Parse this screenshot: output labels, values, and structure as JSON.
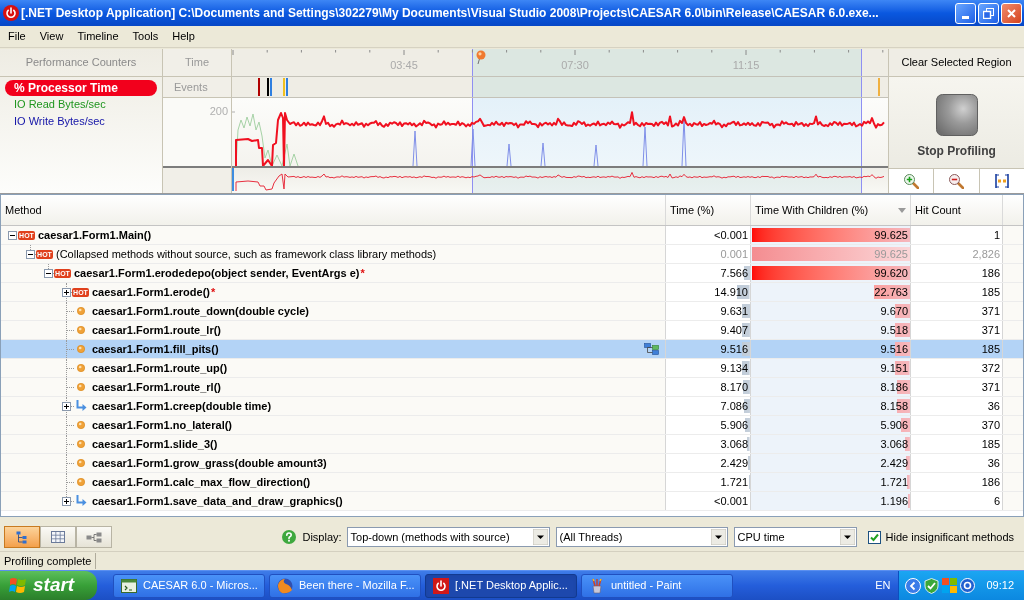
{
  "window": {
    "title": "[.NET Desktop Application] C:\\Documents and Settings\\302279\\My Documents\\Visual Studio 2008\\Projects\\CAESAR 6.0\\bin\\Release\\CAESAR 6.0.exe..."
  },
  "menu": [
    "File",
    "View",
    "Timeline",
    "Tools",
    "Help"
  ],
  "counters": {
    "header": "Performance Counters",
    "items": [
      {
        "label": "% Processor Time",
        "color": "#f2001c",
        "selected": true
      },
      {
        "label": "IO Read Bytes/sec",
        "color": "#1f961f",
        "selected": false
      },
      {
        "label": "IO Write Bytes/sec",
        "color": "#1414a8",
        "selected": false
      }
    ]
  },
  "timeline": {
    "time_label": "Time",
    "events_label": "Events",
    "ticks": [
      "03:45",
      "07:30",
      "11:15"
    ],
    "y_tick": "200",
    "events": [
      {
        "color": "#b00000"
      },
      {
        "color": "#000000"
      },
      {
        "color": "#2f7fe0"
      },
      {
        "color": "#f0c020"
      },
      {
        "color": "#2f7fe0"
      },
      {
        "color": "#f0b040"
      }
    ]
  },
  "actions": {
    "clear": "Clear Selected Region",
    "stop": "Stop Profiling"
  },
  "table": {
    "columns": [
      {
        "label": "Method",
        "sorted": false
      },
      {
        "label": "Time (%)",
        "sorted": false
      },
      {
        "label": "Time With Children (%)",
        "sorted": true
      },
      {
        "label": "Hit Count",
        "sorted": false
      }
    ],
    "rows": [
      {
        "kind": "hot",
        "badge": "HOT",
        "name": "caesar1.Form1.Main()",
        "expanded": true,
        "selected": false,
        "dimmed": false,
        "time": {
          "text": "<0.001"
        },
        "time_with_children": {
          "text": "99.625",
          "level": 0.99625
        },
        "hit_count": "1",
        "children": [
          {
            "kind": "hot",
            "badge": "HOT",
            "name": "(Collapsed methods without source, such as framework class library methods)",
            "expanded": true,
            "selected": false,
            "dimmed": true,
            "time": {
              "text": "0.001"
            },
            "time_with_children": {
              "text": "99.625",
              "level": 0.99625
            },
            "hit_count": "2,826",
            "children": [
              {
                "kind": "hot",
                "badge": "HOT",
                "name": "caesar1.Form1.erodedepo(object sender, EventArgs e)",
                "suffix": "*",
                "expanded": true,
                "selected": false,
                "dimmed": false,
                "time": {
                  "text": "7.566",
                  "level": 0.07566
                },
                "time_with_children": {
                  "text": "99.620",
                  "level": 0.9962
                },
                "hit_count": "186",
                "children": [
                  {
                    "kind": "hot",
                    "badge": "HOT",
                    "name": "caesar1.Form1.erode()",
                    "suffix": "*",
                    "expanded": false,
                    "selected": false,
                    "dimmed": false,
                    "time": {
                      "text": "14.910",
                      "level": 0.1491
                    },
                    "time_with_children": {
                      "text": "22.763",
                      "level": 0.22763
                    },
                    "hit_count": "185"
                  },
                  {
                    "kind": "method",
                    "name": "caesar1.Form1.route_down(double cycle)",
                    "selected": false,
                    "dimmed": false,
                    "time": {
                      "text": "9.631",
                      "level": 0.09631
                    },
                    "time_with_children": {
                      "text": "9.670",
                      "level": 0.0967
                    },
                    "hit_count": "371"
                  },
                  {
                    "kind": "method",
                    "name": "caesar1.Form1.route_lr()",
                    "selected": false,
                    "dimmed": false,
                    "time": {
                      "text": "9.407",
                      "level": 0.09407
                    },
                    "time_with_children": {
                      "text": "9.518",
                      "level": 0.09518
                    },
                    "hit_count": "371"
                  },
                  {
                    "kind": "method",
                    "name": "caesar1.Form1.fill_pits()",
                    "selected": true,
                    "dimmed": false,
                    "time": {
                      "text": "9.516",
                      "level": 0.09516
                    },
                    "time_with_children": {
                      "text": "9.516",
                      "level": 0.09516
                    },
                    "hit_count": "185"
                  },
                  {
                    "kind": "method",
                    "name": "caesar1.Form1.route_up()",
                    "selected": false,
                    "dimmed": false,
                    "time": {
                      "text": "9.134",
                      "level": 0.09134
                    },
                    "time_with_children": {
                      "text": "9.151",
                      "level": 0.09151
                    },
                    "hit_count": "372"
                  },
                  {
                    "kind": "method",
                    "name": "caesar1.Form1.route_rl()",
                    "selected": false,
                    "dimmed": false,
                    "time": {
                      "text": "8.170",
                      "level": 0.0817
                    },
                    "time_with_children": {
                      "text": "8.186",
                      "level": 0.08186
                    },
                    "hit_count": "371"
                  },
                  {
                    "kind": "call",
                    "name": "caesar1.Form1.creep(double time)",
                    "expanded": false,
                    "selected": false,
                    "dimmed": false,
                    "time": {
                      "text": "7.086",
                      "level": 0.07086
                    },
                    "time_with_children": {
                      "text": "8.158",
                      "level": 0.08158
                    },
                    "hit_count": "36"
                  },
                  {
                    "kind": "method",
                    "name": "caesar1.Form1.no_lateral()",
                    "selected": false,
                    "dimmed": false,
                    "time": {
                      "text": "5.906",
                      "level": 0.05906
                    },
                    "time_with_children": {
                      "text": "5.906",
                      "level": 0.05906
                    },
                    "hit_count": "370"
                  },
                  {
                    "kind": "method",
                    "name": "caesar1.Form1.slide_3()",
                    "selected": false,
                    "dimmed": false,
                    "time": {
                      "text": "3.068",
                      "level": 0.03068
                    },
                    "time_with_children": {
                      "text": "3.068",
                      "level": 0.03068
                    },
                    "hit_count": "185"
                  },
                  {
                    "kind": "method",
                    "name": "caesar1.Form1.grow_grass(double amount3)",
                    "selected": false,
                    "dimmed": false,
                    "time": {
                      "text": "2.429",
                      "level": 0.02429
                    },
                    "time_with_children": {
                      "text": "2.429",
                      "level": 0.02429
                    },
                    "hit_count": "36"
                  },
                  {
                    "kind": "method",
                    "name": "caesar1.Form1.calc_max_flow_direction()",
                    "selected": false,
                    "dimmed": false,
                    "time": {
                      "text": "1.721",
                      "level": 0.01721
                    },
                    "time_with_children": {
                      "text": "1.721",
                      "level": 0.01721
                    },
                    "hit_count": "186"
                  },
                  {
                    "kind": "call",
                    "name": "caesar1.Form1.save_data_and_draw_graphics()",
                    "expanded": false,
                    "selected": false,
                    "dimmed": false,
                    "time": {
                      "text": "<0.001"
                    },
                    "time_with_children": {
                      "text": "1.196",
                      "level": 0.01196
                    },
                    "hit_count": "6"
                  }
                ]
              }
            ]
          }
        ]
      }
    ]
  },
  "toolbar": {
    "views": [
      {
        "kind": "tree",
        "selected": true
      },
      {
        "kind": "grid",
        "selected": false
      },
      {
        "kind": "graph",
        "selected": false
      }
    ],
    "display_label": "Display:",
    "dropdowns": [
      "Top-down (methods with source)",
      "(All Threads)",
      "CPU time"
    ],
    "hide_insignificant": {
      "label": "Hide insignificant methods",
      "checked": true
    }
  },
  "status_bar": "Profiling complete",
  "taskbar": {
    "start": "start",
    "tasks": [
      {
        "kind": "ide",
        "label": "CAESAR 6.0 - Micros...",
        "selected": false
      },
      {
        "kind": "browser",
        "label": "Been there - Mozilla F...",
        "selected": false
      },
      {
        "kind": "profiler",
        "label": "[.NET Desktop Applic...",
        "selected": true
      },
      {
        "kind": "paint",
        "label": "untitled - Paint",
        "selected": false
      }
    ],
    "language": "EN",
    "clock": "09:12"
  }
}
